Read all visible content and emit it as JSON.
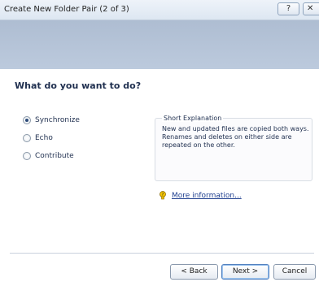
{
  "window": {
    "title": "Create New Folder Pair (2 of 3)",
    "help_button": "?",
    "close_button": "✕"
  },
  "page": {
    "heading": "What do you want to do?"
  },
  "options": [
    {
      "label": "Synchronize",
      "checked": true
    },
    {
      "label": "Echo",
      "checked": false
    },
    {
      "label": "Contribute",
      "checked": false
    }
  ],
  "explanation": {
    "title": "Short Explanation",
    "text": "New and updated files are copied both ways. Renames and deletes on either side are repeated on the other."
  },
  "more_info": {
    "label": "More information...",
    "icon": "question-bulb-icon"
  },
  "buttons": {
    "back": "< Back",
    "next": "Next >",
    "cancel": "Cancel"
  },
  "colors": {
    "banner": "#b3c2d7",
    "heading": "#1f2f4f",
    "link": "#1f3f8f"
  }
}
